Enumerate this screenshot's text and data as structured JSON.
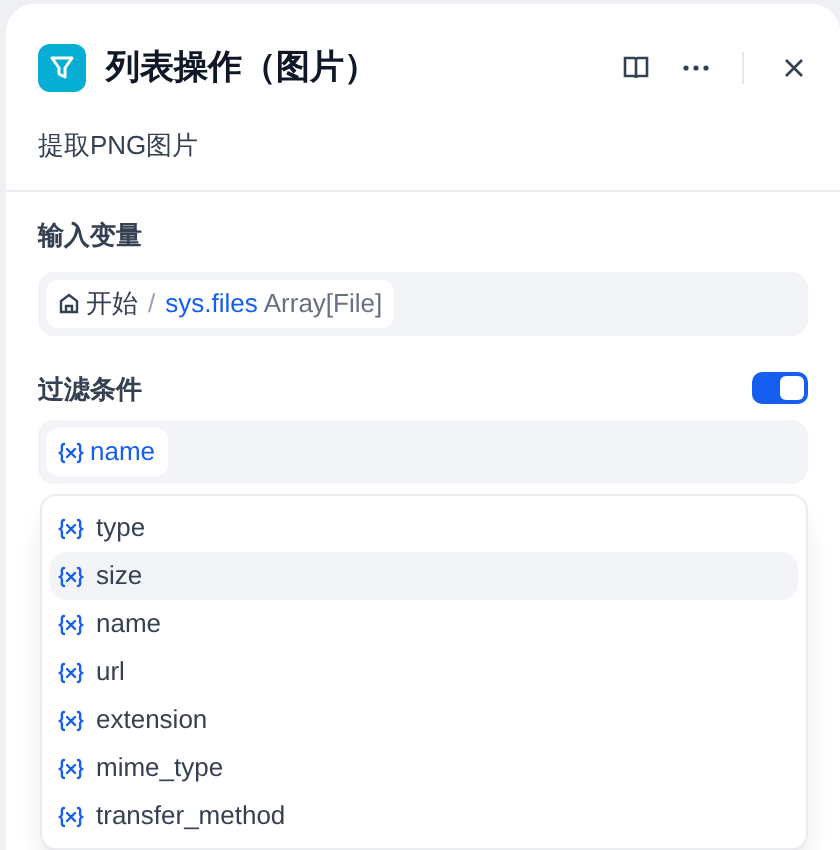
{
  "header": {
    "title": "列表操作（图片）",
    "description": "提取PNG图片"
  },
  "input_variable": {
    "label": "输入变量",
    "node": "开始",
    "separator": "/",
    "variable": "sys.files",
    "type": "Array[File]"
  },
  "filter": {
    "label": "过滤条件",
    "on": true,
    "variable": "name"
  },
  "dropdown": {
    "items": [
      {
        "label": "type",
        "selected": false
      },
      {
        "label": "size",
        "selected": true
      },
      {
        "label": "name",
        "selected": false
      },
      {
        "label": "url",
        "selected": false
      },
      {
        "label": "extension",
        "selected": false
      },
      {
        "label": "mime_type",
        "selected": false
      },
      {
        "label": "transfer_method",
        "selected": false
      }
    ]
  }
}
